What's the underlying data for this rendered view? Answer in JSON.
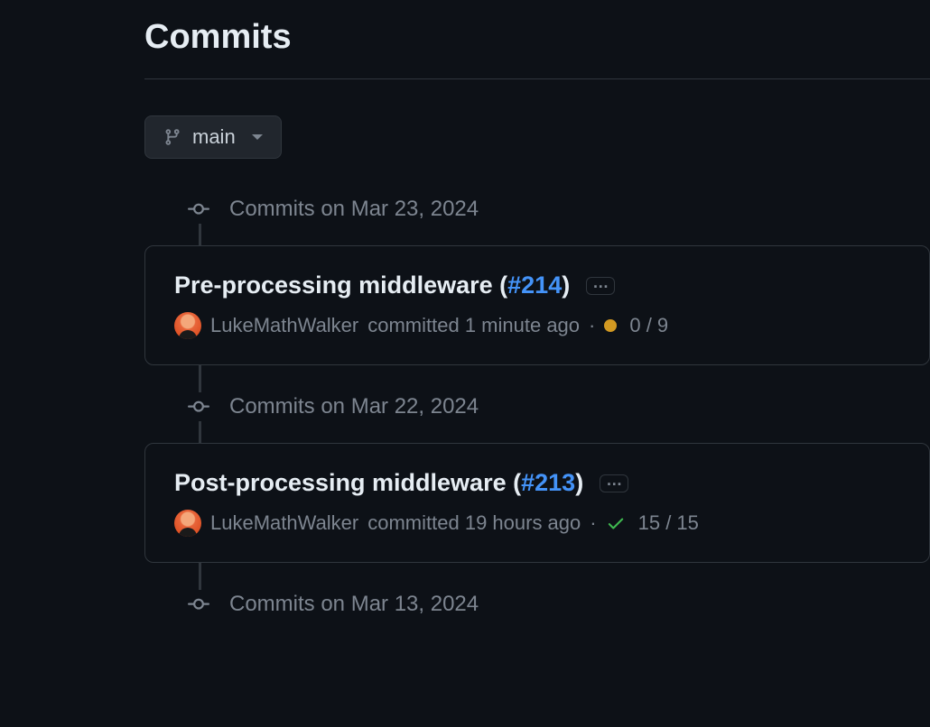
{
  "page": {
    "title": "Commits"
  },
  "branch": {
    "label": "main"
  },
  "timeline": {
    "groups": [
      {
        "date_label": "Commits on Mar 23, 2024",
        "commits": [
          {
            "title": "Pre-processing middleware",
            "pr_number": "#214",
            "author": "LukeMathWalker",
            "committed_text": "committed 1 minute ago",
            "status": "pending",
            "checks": "0 / 9"
          }
        ]
      },
      {
        "date_label": "Commits on Mar 22, 2024",
        "commits": [
          {
            "title": "Post-processing middleware",
            "pr_number": "#213",
            "author": "LukeMathWalker",
            "committed_text": "committed 19 hours ago",
            "status": "success",
            "checks": "15 / 15"
          }
        ]
      },
      {
        "date_label": "Commits on Mar 13, 2024",
        "commits": []
      }
    ]
  }
}
